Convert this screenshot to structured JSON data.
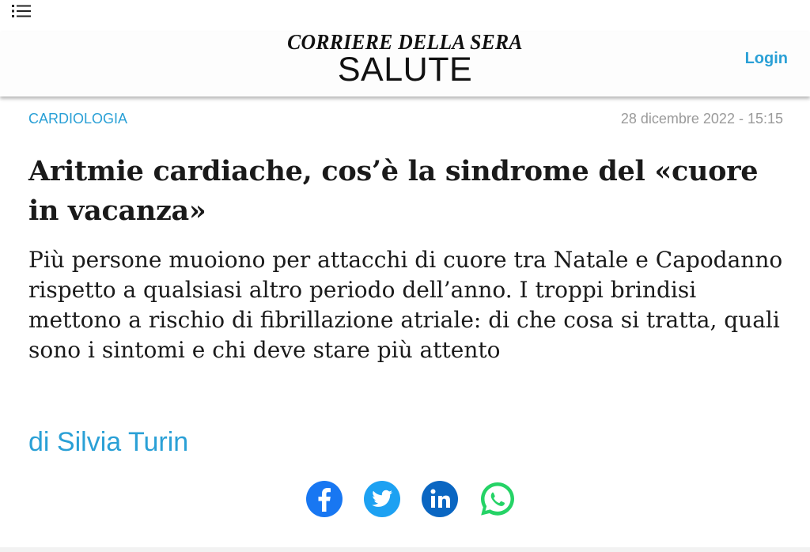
{
  "header": {
    "brand": "CORRIERE DELLA SERA",
    "section": "SALUTE",
    "login_label": "Login",
    "menu_icon": "list-menu-icon"
  },
  "article": {
    "category": "CARDIOLOGIA",
    "date": "28 dicembre 2022 - 15:15",
    "title": "Aritmie cardiache, cos’è la sindrome del «cuore in vacanza»",
    "subtitle": "Più persone muoiono per attacchi di cuore tra Natale e Capodanno rispetto a qualsiasi altro periodo dell’anno. I troppi brindisi mettono a rischio di fibrillazione atriale: di che cosa si tratta, quali sono i sintomi e chi deve stare più attento",
    "author": "di Silvia Turin"
  },
  "share": [
    {
      "icon": "facebook-icon",
      "color": "#1877f2"
    },
    {
      "icon": "twitter-icon",
      "color": "#1da1f2"
    },
    {
      "icon": "linkedin-icon",
      "color": "#0a66c2"
    },
    {
      "icon": "whatsapp-icon",
      "color": "#25d366"
    }
  ],
  "colors": {
    "accent": "#2aa0d6",
    "date": "#9a9a9a",
    "text": "#1a1a1a"
  }
}
